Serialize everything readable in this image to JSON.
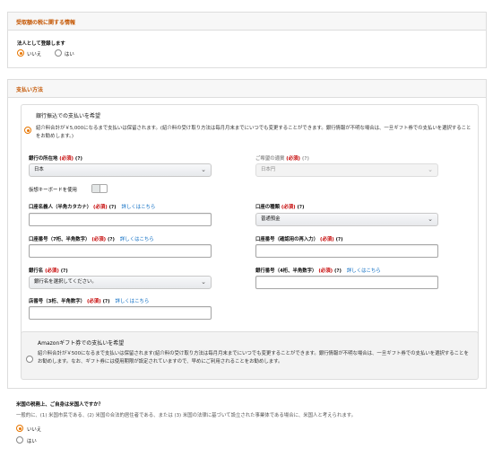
{
  "tax_section": {
    "title": "受取額の税に関する情報",
    "corp_question": "法人として登録します",
    "options": [
      "いいえ",
      "はい"
    ],
    "selected": "いいえ"
  },
  "payment_section": {
    "title": "支払い方法",
    "bank": {
      "heading": "銀行振込での支払いを希望",
      "desc": "紹介料合計が￥5,000になるまで支払いは保留されます。(紹介料の受け取り方法は毎月月末までにいつでも変更することができます。銀行情報が不明な場合は、一旦ギフト券での支払いを選択することをお勧めします。)",
      "country_label": "銀行の所在地",
      "currency_label": "ご希望の通貨",
      "required": "(必須)",
      "help": "(?)",
      "country_value": "日本",
      "currency_value": "日本円",
      "virtual_keyboard": "仮想キーボードを使用",
      "holder_label": "口座名義人（半角カタカナ）",
      "account_type_label": "口座の種類",
      "account_type_value": "普通預金",
      "account_no_label": "口座番号（7桁、半角数字）",
      "account_no_confirm_label": "口座番号（確認用の再入力）",
      "bank_name_label": "銀行名",
      "bank_name_placeholder": "銀行名を選択してください。",
      "bank_code_label": "銀行番号（4桁、半角数字）",
      "branch_label": "店番号（3桁、半角数字）",
      "details_link": "詳しくはこちら"
    },
    "gift": {
      "heading": "Amazonギフト券での支払いを希望",
      "desc": "紹介料合計が￥500になるまで支払いは保留されます(紹介料の受け取り方法は毎月月末までにいつでも変更することができます。銀行情報が不明な場合は、一旦ギフト券での支払いを選択することをお勧めします。なお、ギフト券には使用期限が設定されていますので、早めにご利用されることをお勧めします。"
    }
  },
  "us_section": {
    "question": "米国の税務上、ご自身は米国人ですか？",
    "note": "一般的に、(1) 米国市民である、(2) 米国の合法的居住者である、または (3) 米国の法律に基づいて設立された事業体である場合に、米国人と考えられます。",
    "options": [
      "いいえ",
      "はい"
    ],
    "selected": "いいえ"
  },
  "colors": {
    "accent": "#e77600",
    "title": "#c45500",
    "required": "#c40000",
    "link": "#0066c0"
  }
}
